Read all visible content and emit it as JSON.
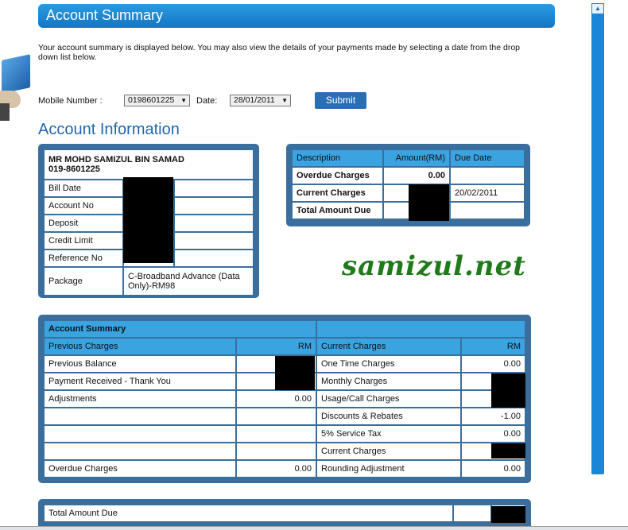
{
  "header": {
    "title": "Account Summary"
  },
  "intro": {
    "text": "Your account summary is displayed below. You may also view the details of your payments made by selecting a date from the drop down list below."
  },
  "form": {
    "mobile_label": "Mobile Number :",
    "mobile_value": "0198601225",
    "date_label": "Date:",
    "date_value": "28/01/2011",
    "submit_label": "Submit"
  },
  "account_info": {
    "title": "Account Information",
    "name": "MR MOHD SAMIZUL BIN SAMAD",
    "phone": "019-8601225",
    "rows": [
      {
        "label": "Bill Date",
        "value": ""
      },
      {
        "label": "Account No",
        "value": ""
      },
      {
        "label": "Deposit",
        "value": ""
      },
      {
        "label": "Credit Limit",
        "value": ""
      },
      {
        "label": "Reference No",
        "value": ""
      }
    ],
    "package_label": "Package",
    "package_value": "C-Broadband Advance (Data Only)-RM98"
  },
  "due_table": {
    "headers": [
      "Description",
      "Amount(RM)",
      "Due Date"
    ],
    "rows": [
      {
        "desc": "Overdue Charges",
        "amount": "0.00",
        "due": ""
      },
      {
        "desc": "Current Charges",
        "amount": "",
        "due": "20/02/2011"
      },
      {
        "desc": "Total Amount Due",
        "amount": "",
        "due": ""
      }
    ]
  },
  "watermark": "samizul.net",
  "summary": {
    "title": "Account Summary",
    "left_header": "Previous Charges",
    "left_rm": "RM",
    "right_header": "Current Charges",
    "right_rm": "RM",
    "left_rows": [
      {
        "label": "Previous Balance",
        "value": ""
      },
      {
        "label": "Payment Received - Thank You",
        "value": ""
      },
      {
        "label": "Adjustments",
        "value": "0.00"
      },
      {
        "label": "",
        "value": ""
      },
      {
        "label": "",
        "value": ""
      },
      {
        "label": "",
        "value": ""
      },
      {
        "label": "Overdue Charges",
        "value": "0.00"
      }
    ],
    "right_rows": [
      {
        "label": "One Time Charges",
        "value": "0.00"
      },
      {
        "label": "Monthly Charges",
        "value": ""
      },
      {
        "label": "Usage/Call Charges",
        "value": ""
      },
      {
        "label": "Discounts & Rebates",
        "value": "-1.00"
      },
      {
        "label": "5% Service Tax",
        "value": "0.00"
      },
      {
        "label": "Current Charges",
        "value": ""
      },
      {
        "label": "Rounding Adjustment",
        "value": "0.00"
      }
    ]
  },
  "total": {
    "label": "Total Amount Due",
    "value": ""
  },
  "colors": {
    "accent": "#2a9be0",
    "frame": "#3a6f9d",
    "header_cell": "#3aa3e0",
    "watermark": "#1f7a1a"
  },
  "icons": {
    "scroll_up": "scroll-up-arrow-icon",
    "select_arrow": "dropdown-arrow-icon"
  }
}
